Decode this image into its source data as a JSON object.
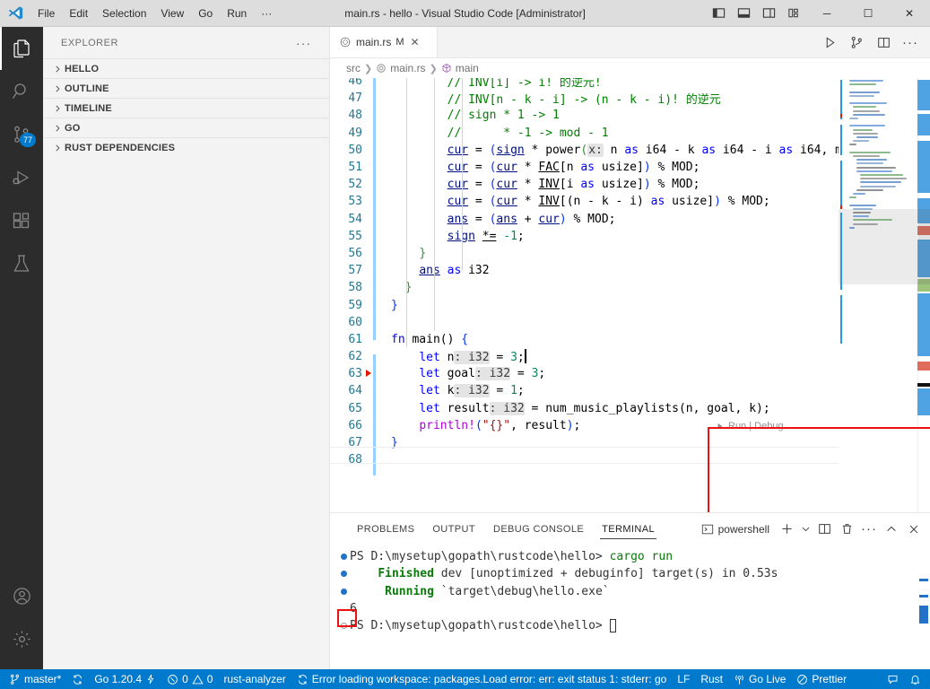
{
  "titlebar": {
    "menus": [
      "File",
      "Edit",
      "Selection",
      "View",
      "Go",
      "Run",
      "···"
    ],
    "title": "main.rs - hello - Visual Studio Code [Administrator]",
    "layout_icons": [
      "panel-left-icon",
      "panel-bottom-icon",
      "panel-right-icon",
      "customize-layout-icon"
    ],
    "window_controls": {
      "minimize": "─",
      "maximize": "☐",
      "close": "✕"
    }
  },
  "activitybar": {
    "items": [
      {
        "name": "explorer",
        "icon": "files-icon",
        "badge": ""
      },
      {
        "name": "search",
        "icon": "search-icon",
        "badge": ""
      },
      {
        "name": "source-control",
        "icon": "source-control-icon",
        "badge": "77"
      },
      {
        "name": "run-and-debug",
        "icon": "debug-icon",
        "badge": ""
      },
      {
        "name": "extensions",
        "icon": "extensions-icon",
        "badge": ""
      },
      {
        "name": "testing",
        "icon": "beaker-icon",
        "badge": ""
      }
    ],
    "bottom": [
      {
        "name": "accounts",
        "icon": "account-icon"
      },
      {
        "name": "manage",
        "icon": "gear-icon"
      }
    ]
  },
  "sidebar": {
    "title": "EXPLORER",
    "more": "···",
    "sections": [
      "HELLO",
      "OUTLINE",
      "TIMELINE",
      "GO",
      "RUST DEPENDENCIES"
    ]
  },
  "editor": {
    "tab": {
      "filename": "main.rs",
      "modified_badge": "M",
      "close": "✕",
      "icon": "rust-file-icon"
    },
    "tab_actions": [
      "run-icon",
      "split-run-icon",
      "split-editor-icon",
      "more-actions-icon"
    ],
    "breadcrumbs": [
      "src",
      "main.rs",
      "main"
    ],
    "codelens": "Run | Debug",
    "first_line_number": 46,
    "lines": [
      {
        "n": 46,
        "tokens": [
          {
            "t": "        ",
            "c": "c-plain"
          },
          {
            "t": "// INV[i] -> i! 的逆元!",
            "c": "c-comment"
          }
        ]
      },
      {
        "n": 47,
        "tokens": [
          {
            "t": "        ",
            "c": "c-plain"
          },
          {
            "t": "// INV[n - k - i] -> (n - k - i)! 的逆元",
            "c": "c-comment"
          }
        ]
      },
      {
        "n": 48,
        "tokens": [
          {
            "t": "        ",
            "c": "c-plain"
          },
          {
            "t": "// sign * 1 -> 1",
            "c": "c-comment"
          }
        ]
      },
      {
        "n": 49,
        "tokens": [
          {
            "t": "        ",
            "c": "c-plain"
          },
          {
            "t": "//      * -1 -> mod - 1",
            "c": "c-comment"
          }
        ]
      },
      {
        "n": 50,
        "tokens": [
          {
            "t": "        ",
            "c": "c-plain"
          },
          {
            "t": "cur",
            "c": "c-var c-mut"
          },
          {
            "t": " = ",
            "c": "c-op"
          },
          {
            "t": "(",
            "c": "c-brace1"
          },
          {
            "t": "sign",
            "c": "c-var c-mut"
          },
          {
            "t": " * ",
            "c": "c-op"
          },
          {
            "t": "power",
            "c": "c-plain"
          },
          {
            "t": "(",
            "c": "c-brace2"
          },
          {
            "t": "x:",
            "c": "c-param"
          },
          {
            "t": " n ",
            "c": "c-plain"
          },
          {
            "t": "as",
            "c": "c-kw"
          },
          {
            "t": " i64 ",
            "c": "c-plain"
          },
          {
            "t": "-",
            "c": "c-op"
          },
          {
            "t": " k ",
            "c": "c-plain"
          },
          {
            "t": "as",
            "c": "c-kw"
          },
          {
            "t": " i64 ",
            "c": "c-plain"
          },
          {
            "t": "-",
            "c": "c-op"
          },
          {
            "t": " i ",
            "c": "c-plain"
          },
          {
            "t": "as",
            "c": "c-kw"
          },
          {
            "t": " i64, ",
            "c": "c-plain"
          },
          {
            "t": "m",
            "c": "c-plain"
          }
        ]
      },
      {
        "n": 51,
        "tokens": [
          {
            "t": "        ",
            "c": "c-plain"
          },
          {
            "t": "cur",
            "c": "c-var c-mut"
          },
          {
            "t": " = ",
            "c": "c-op"
          },
          {
            "t": "(",
            "c": "c-brace1"
          },
          {
            "t": "cur",
            "c": "c-var c-mut"
          },
          {
            "t": " * ",
            "c": "c-op"
          },
          {
            "t": "FAC",
            "c": "c-plain c-mut"
          },
          {
            "t": "[n ",
            "c": "c-plain"
          },
          {
            "t": "as",
            "c": "c-kw"
          },
          {
            "t": " usize]",
            "c": "c-plain"
          },
          {
            "t": ")",
            "c": "c-brace1"
          },
          {
            "t": " % MOD;",
            "c": "c-plain"
          }
        ]
      },
      {
        "n": 52,
        "tokens": [
          {
            "t": "        ",
            "c": "c-plain"
          },
          {
            "t": "cur",
            "c": "c-var c-mut"
          },
          {
            "t": " = ",
            "c": "c-op"
          },
          {
            "t": "(",
            "c": "c-brace1"
          },
          {
            "t": "cur",
            "c": "c-var c-mut"
          },
          {
            "t": " * ",
            "c": "c-op"
          },
          {
            "t": "INV",
            "c": "c-plain c-mut"
          },
          {
            "t": "[i ",
            "c": "c-plain"
          },
          {
            "t": "as",
            "c": "c-kw"
          },
          {
            "t": " usize]",
            "c": "c-plain"
          },
          {
            "t": ")",
            "c": "c-brace1"
          },
          {
            "t": " % MOD;",
            "c": "c-plain"
          }
        ]
      },
      {
        "n": 53,
        "tokens": [
          {
            "t": "        ",
            "c": "c-plain"
          },
          {
            "t": "cur",
            "c": "c-var c-mut"
          },
          {
            "t": " = ",
            "c": "c-op"
          },
          {
            "t": "(",
            "c": "c-brace1"
          },
          {
            "t": "cur",
            "c": "c-var c-mut"
          },
          {
            "t": " * ",
            "c": "c-op"
          },
          {
            "t": "INV",
            "c": "c-plain c-mut"
          },
          {
            "t": "[(n - k - i) ",
            "c": "c-plain"
          },
          {
            "t": "as",
            "c": "c-kw"
          },
          {
            "t": " usize]",
            "c": "c-plain"
          },
          {
            "t": ")",
            "c": "c-brace1"
          },
          {
            "t": " % MOD;",
            "c": "c-plain"
          }
        ]
      },
      {
        "n": 54,
        "tokens": [
          {
            "t": "        ",
            "c": "c-plain"
          },
          {
            "t": "ans",
            "c": "c-var c-mut"
          },
          {
            "t": " = ",
            "c": "c-op"
          },
          {
            "t": "(",
            "c": "c-brace1"
          },
          {
            "t": "ans",
            "c": "c-var c-mut"
          },
          {
            "t": " + ",
            "c": "c-op"
          },
          {
            "t": "cur",
            "c": "c-var c-mut"
          },
          {
            "t": ")",
            "c": "c-brace1"
          },
          {
            "t": " % MOD;",
            "c": "c-plain"
          }
        ]
      },
      {
        "n": 55,
        "tokens": [
          {
            "t": "        ",
            "c": "c-plain"
          },
          {
            "t": "sign",
            "c": "c-var c-mut"
          },
          {
            "t": " ",
            "c": "c-plain"
          },
          {
            "t": "*=",
            "c": "c-op c-mut"
          },
          {
            "t": " ",
            "c": "c-plain"
          },
          {
            "t": "-1",
            "c": "c-num"
          },
          {
            "t": ";",
            "c": "c-plain"
          }
        ]
      },
      {
        "n": 56,
        "tokens": [
          {
            "t": "    ",
            "c": "c-plain"
          },
          {
            "t": "}",
            "c": "c-brace2"
          }
        ]
      },
      {
        "n": 57,
        "tokens": [
          {
            "t": "    ",
            "c": "c-plain"
          },
          {
            "t": "ans",
            "c": "c-var c-mut"
          },
          {
            "t": " ",
            "c": "c-plain"
          },
          {
            "t": "as",
            "c": "c-kw"
          },
          {
            "t": " i32",
            "c": "c-plain"
          }
        ]
      },
      {
        "n": 58,
        "tokens": [
          {
            "t": "  ",
            "c": "c-plain"
          },
          {
            "t": "}",
            "c": "c-brace2"
          }
        ]
      },
      {
        "n": 59,
        "tokens": [
          {
            "t": "}",
            "c": "c-brace1"
          }
        ]
      },
      {
        "n": 60,
        "tokens": []
      },
      {
        "n": 61,
        "tokens": [
          {
            "t": "fn",
            "c": "c-kw"
          },
          {
            "t": " ",
            "c": "c-plain"
          },
          {
            "t": "main",
            "c": "c-plain"
          },
          {
            "t": "()",
            "c": "c-plain"
          },
          {
            "t": " ",
            "c": "c-plain"
          },
          {
            "t": "{",
            "c": "c-brace1"
          }
        ]
      },
      {
        "n": 62,
        "tokens": [
          {
            "t": "    ",
            "c": "c-plain"
          },
          {
            "t": "let",
            "c": "c-kw"
          },
          {
            "t": " n",
            "c": "c-plain"
          },
          {
            "t": ": i32",
            "c": "c-hint"
          },
          {
            "t": " = ",
            "c": "c-plain"
          },
          {
            "t": "3",
            "c": "c-num"
          },
          {
            "t": ";",
            "c": "c-plain"
          }
        ]
      },
      {
        "n": 63,
        "tokens": [
          {
            "t": "    ",
            "c": "c-plain"
          },
          {
            "t": "let",
            "c": "c-kw"
          },
          {
            "t": " goal",
            "c": "c-plain"
          },
          {
            "t": ": i32",
            "c": "c-hint"
          },
          {
            "t": " = ",
            "c": "c-plain"
          },
          {
            "t": "3",
            "c": "c-num"
          },
          {
            "t": ";",
            "c": "c-plain"
          }
        ]
      },
      {
        "n": 64,
        "tokens": [
          {
            "t": "    ",
            "c": "c-plain"
          },
          {
            "t": "let",
            "c": "c-kw"
          },
          {
            "t": " k",
            "c": "c-plain"
          },
          {
            "t": ": i32",
            "c": "c-hint"
          },
          {
            "t": " = ",
            "c": "c-plain"
          },
          {
            "t": "1",
            "c": "c-num"
          },
          {
            "t": ";",
            "c": "c-plain"
          }
        ]
      },
      {
        "n": 65,
        "tokens": [
          {
            "t": "    ",
            "c": "c-plain"
          },
          {
            "t": "let",
            "c": "c-kw"
          },
          {
            "t": " result",
            "c": "c-plain"
          },
          {
            "t": ": i32",
            "c": "c-hint"
          },
          {
            "t": " = ",
            "c": "c-plain"
          },
          {
            "t": "num_music_playlists",
            "c": "c-plain"
          },
          {
            "t": "(n, goal, k);",
            "c": "c-plain"
          }
        ]
      },
      {
        "n": 66,
        "tokens": [
          {
            "t": "    ",
            "c": "c-plain"
          },
          {
            "t": "println!",
            "c": "c-ctl"
          },
          {
            "t": "(",
            "c": "c-brace1"
          },
          {
            "t": "\"{}\"",
            "c": "c-str"
          },
          {
            "t": ", result",
            "c": "c-plain"
          },
          {
            "t": ")",
            "c": "c-brace1"
          },
          {
            "t": ";",
            "c": "c-plain"
          }
        ]
      },
      {
        "n": 67,
        "tokens": [
          {
            "t": "}",
            "c": "c-brace1"
          }
        ]
      },
      {
        "n": 68,
        "tokens": []
      }
    ]
  },
  "panel": {
    "tabs": [
      "PROBLEMS",
      "OUTPUT",
      "DEBUG CONSOLE",
      "TERMINAL"
    ],
    "active_tab": "TERMINAL",
    "terminal_name": "powershell",
    "actions": [
      "new-terminal-icon",
      "terminal-dropdown-icon",
      "split-terminal-icon",
      "kill-terminal-icon",
      "more-actions-icon",
      "maximize-panel-icon",
      "close-panel-icon"
    ],
    "lines": [
      {
        "deco": "blue",
        "segments": [
          {
            "t": "PS D:\\mysetup\\gopath\\rustcode\\hello> ",
            "c": "t-path"
          },
          {
            "t": "cargo run",
            "c": "t-cmd"
          }
        ]
      },
      {
        "deco": "blue",
        "segments": [
          {
            "t": "    ",
            "c": "t-path"
          },
          {
            "t": "Finished",
            "c": "t-green"
          },
          {
            "t": " dev [unoptimized + debuginfo] target(s) in 0.53s",
            "c": "t-path"
          }
        ]
      },
      {
        "deco": "blue",
        "segments": [
          {
            "t": "     ",
            "c": "t-path"
          },
          {
            "t": "Running",
            "c": "t-green"
          },
          {
            "t": " `target\\debug\\hello.exe`",
            "c": "t-path"
          }
        ]
      },
      {
        "deco": "none",
        "segments": [
          {
            "t": "6",
            "c": "t-path"
          }
        ]
      },
      {
        "deco": "hollow",
        "segments": [
          {
            "t": "PS D:\\mysetup\\gopath\\rustcode\\hello> ",
            "c": "t-path"
          }
        ]
      }
    ],
    "output_value": "6"
  },
  "statusbar": {
    "left": [
      {
        "icon": "source-control-icon",
        "label": "master*"
      },
      {
        "icon": "sync-icon",
        "label": ""
      },
      {
        "icon": "",
        "label": "Go 1.20.4"
      },
      {
        "icon": "zap-icon",
        "label": ""
      },
      {
        "icon": "error-icon",
        "label": "0",
        "icon2": "warning-icon",
        "label2": "0"
      },
      {
        "icon": "",
        "label": "rust-analyzer"
      },
      {
        "icon": "sync-icon",
        "label": "Error loading workspace: packages.Load error: err: exit status 1: stderr: go"
      },
      {
        "icon": "",
        "label": "LF"
      },
      {
        "icon": "",
        "label": "Rust"
      },
      {
        "icon": "broadcast-icon",
        "label": "Go Live"
      },
      {
        "icon": "prettier-icon",
        "label": "Prettier"
      }
    ],
    "right": [
      {
        "icon": "feedback-icon",
        "label": ""
      },
      {
        "icon": "bell-icon",
        "label": ""
      }
    ]
  },
  "colors": {
    "accent": "#007acc",
    "titlebar_bg": "#dddddd",
    "sidebar_bg": "#f3f3f3",
    "activitybar_bg": "#2c2c2c",
    "editor_bg": "#ffffff",
    "redbox": "#ee1111",
    "comment": "#008000",
    "keyword": "#0000ff",
    "string": "#a31515",
    "number": "#098658",
    "linenum": "#237893"
  }
}
